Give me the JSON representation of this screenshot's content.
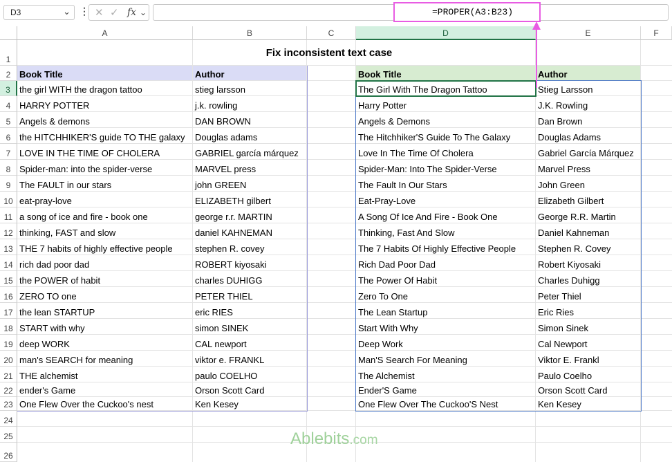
{
  "name_box": {
    "value": "D3"
  },
  "formula_bar": {
    "formula": "=PROPER(A3:B23)",
    "fx_label": "fx",
    "cancel": "✕",
    "enter": "✓"
  },
  "columns": [
    "A",
    "B",
    "C",
    "D",
    "E",
    "F"
  ],
  "rows": [
    "1",
    "2",
    "3",
    "4",
    "5",
    "6",
    "7",
    "8",
    "9",
    "10",
    "11",
    "12",
    "13",
    "14",
    "15",
    "16",
    "17",
    "18",
    "19",
    "20",
    "21",
    "22",
    "23",
    "24",
    "25",
    "26"
  ],
  "sheet": {
    "title": "Fix inconsistent text case",
    "source_headers": [
      "Book Title",
      "Author"
    ],
    "result_headers": [
      "Book Title",
      "Author"
    ],
    "source_rows": [
      [
        "the girl WITH the dragon tattoo",
        "stieg larsson"
      ],
      [
        "HARRY POTTER",
        "j.k. rowling"
      ],
      [
        "Angels & demons",
        "DAN BROWN"
      ],
      [
        "the HITCHHIKER'S guide TO THE galaxy",
        "Douglas adams"
      ],
      [
        "LOVE IN THE TIME OF CHOLERA",
        "GABRIEL garcía márquez"
      ],
      [
        "Spider-man: into the spider-verse",
        "MARVEL press"
      ],
      [
        "The FAULT in our stars",
        "john GREEN"
      ],
      [
        "eat-pray-love",
        "ELIZABETH gilbert"
      ],
      [
        "a song of ice and fire - book one",
        "george r.r. MARTIN"
      ],
      [
        "thinking, FAST and slow",
        "daniel KAHNEMAN"
      ],
      [
        "THE 7 habits of highly effective people",
        "stephen R. covey"
      ],
      [
        "rich dad poor dad",
        "ROBERT kiyosaki"
      ],
      [
        "the POWER of habit",
        "charles DUHIGG"
      ],
      [
        "ZERO TO one",
        "PETER THIEL"
      ],
      [
        "the lean STARTUP",
        "eric RIES"
      ],
      [
        "START with why",
        "simon SINEK"
      ],
      [
        "deep WORK",
        "CAL newport"
      ],
      [
        "man's SEARCH for meaning",
        "viktor e. FRANKL"
      ],
      [
        "THE alchemist",
        "paulo COELHO"
      ],
      [
        "ender's Game",
        "Orson Scott Card"
      ],
      [
        "One Flew Over the Cuckoo's nest",
        "Ken Kesey"
      ]
    ],
    "result_rows": [
      [
        "The Girl With The Dragon Tattoo",
        "Stieg Larsson"
      ],
      [
        "Harry Potter",
        "J.K. Rowling"
      ],
      [
        "Angels & Demons",
        "Dan Brown"
      ],
      [
        "The Hitchhiker'S Guide To The Galaxy",
        "Douglas Adams"
      ],
      [
        "Love In The Time Of Cholera",
        "Gabriel García Márquez"
      ],
      [
        "Spider-Man: Into The Spider-Verse",
        "Marvel Press"
      ],
      [
        "The Fault In Our Stars",
        "John Green"
      ],
      [
        "Eat-Pray-Love",
        "Elizabeth Gilbert"
      ],
      [
        "A Song Of Ice And Fire - Book One",
        "George R.R. Martin"
      ],
      [
        "Thinking, Fast And Slow",
        "Daniel Kahneman"
      ],
      [
        "The 7 Habits Of Highly Effective People",
        "Stephen R. Covey"
      ],
      [
        "Rich Dad Poor Dad",
        "Robert Kiyosaki"
      ],
      [
        "The Power Of Habit",
        "Charles Duhigg"
      ],
      [
        "Zero To One",
        "Peter Thiel"
      ],
      [
        "The Lean Startup",
        "Eric Ries"
      ],
      [
        "Start With Why",
        "Simon Sinek"
      ],
      [
        "Deep Work",
        "Cal Newport"
      ],
      [
        "Man'S Search For Meaning",
        "Viktor E. Frankl"
      ],
      [
        "The Alchemist",
        "Paulo Coelho"
      ],
      [
        "Ender'S Game",
        "Orson Scott Card"
      ],
      [
        "One Flew Over The Cuckoo'S Nest",
        "Ken Kesey"
      ]
    ]
  },
  "watermark": {
    "brand": "Ablebits",
    "suffix": ".com"
  },
  "colors": {
    "accent": "#217346",
    "highlight": "#e85ce3",
    "source_header_fill": "#dadcf6",
    "result_header_fill": "#d7ecd1"
  }
}
